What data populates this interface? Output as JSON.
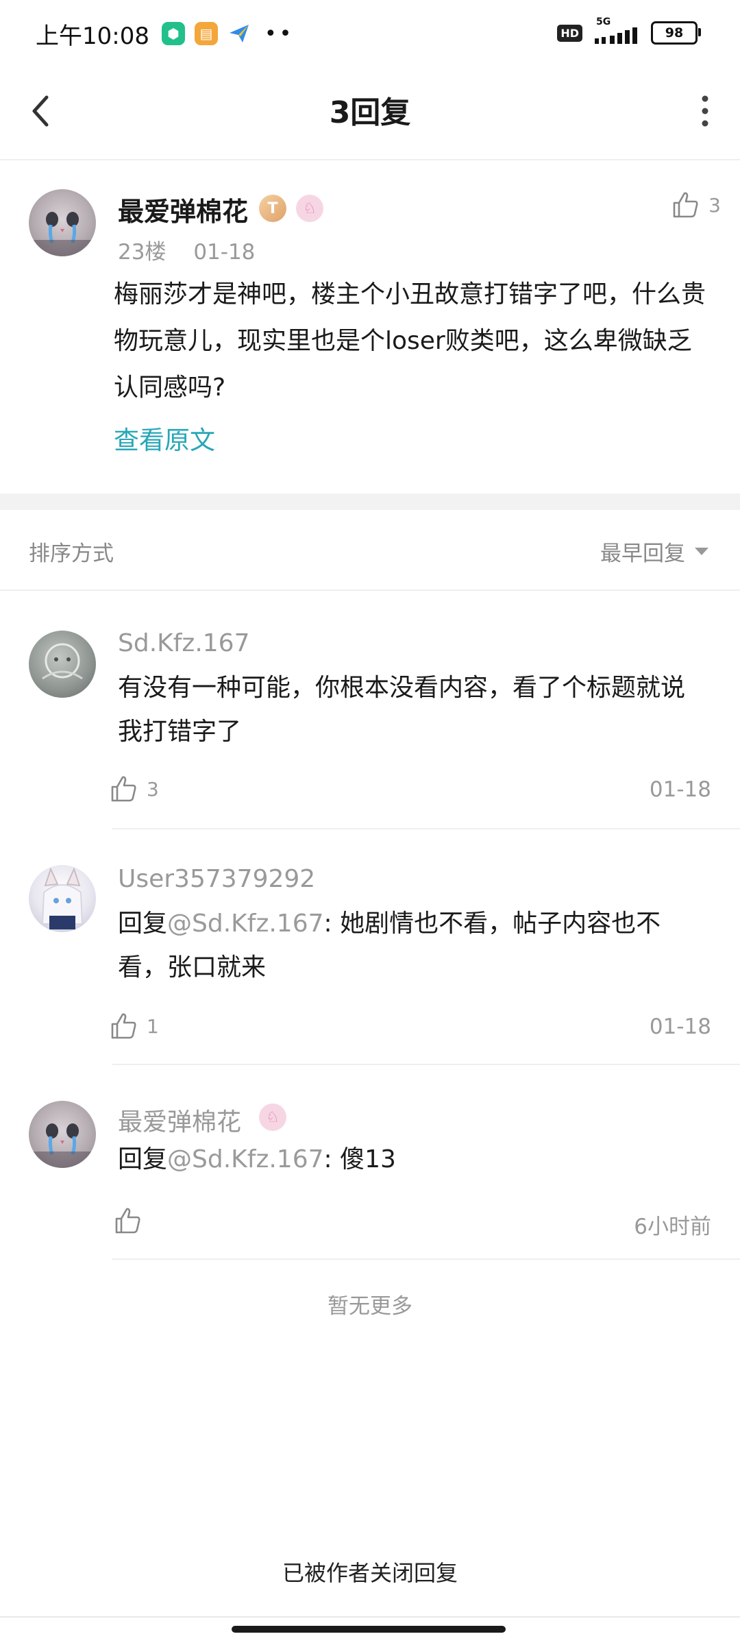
{
  "status_bar": {
    "time": "上午10:08",
    "hd": "HD",
    "network": "5G",
    "battery": "98",
    "dots": "••"
  },
  "header": {
    "title": "3回复"
  },
  "main_post": {
    "author": "最爱弹棉花",
    "level_badge": "T",
    "floor": "23楼",
    "date": "01-18",
    "like_count": "3",
    "body": "梅丽莎才是神吧，楼主个小丑故意打错字了吧，什么贵物玩意儿，现实里也是个loser败类吧，这么卑微缺乏认同感吗?",
    "view_original": "查看原文"
  },
  "sort": {
    "label": "排序方式",
    "value": "最早回复"
  },
  "replies": [
    {
      "name": "Sd.Kfz.167",
      "body": "有没有一种可能，你根本没看内容，看了个标题就说我打错字了",
      "like_count": "3",
      "date": "01-18"
    },
    {
      "name": "User357379292",
      "prefix": "回复",
      "mention": "@Sd.Kfz.167",
      "body": ": 她剧情也不看，帖子内容也不看，张口就来",
      "like_count": "1",
      "date": "01-18"
    },
    {
      "name": "最爱弹棉花",
      "prefix": "回复",
      "mention": "@Sd.Kfz.167",
      "body": ": 傻13",
      "like_count": "",
      "date": "6小时前"
    }
  ],
  "footer": {
    "no_more": "暂无更多",
    "closed_note": "已被作者关闭回复"
  },
  "colors": {
    "accent": "#27a7b8",
    "muted": "#999999",
    "text": "#1a1a1a"
  }
}
